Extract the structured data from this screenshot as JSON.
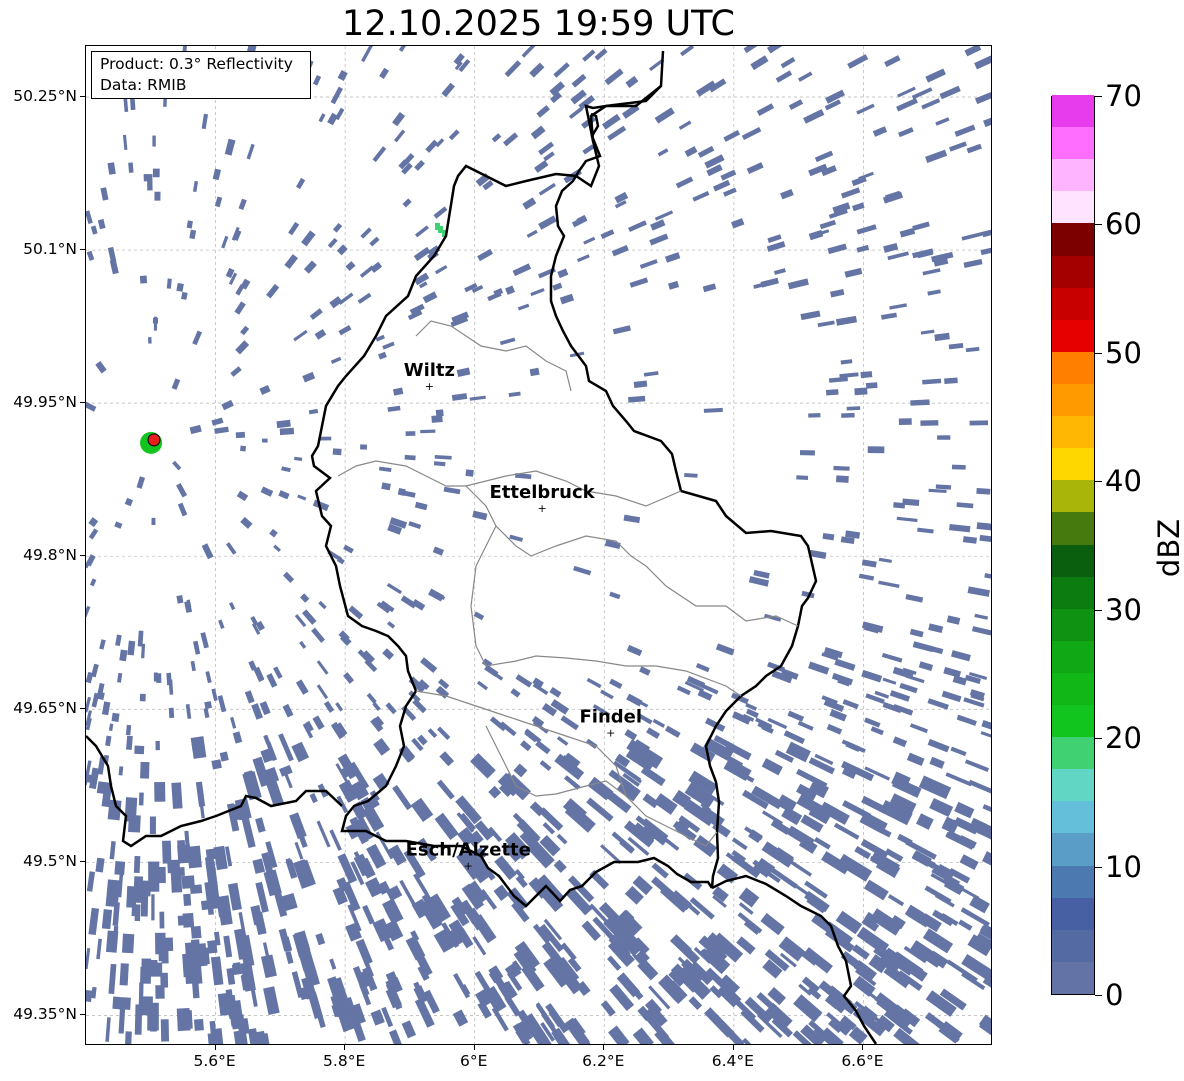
{
  "title": "12.10.2025 19:59 UTC",
  "info_box": {
    "product": "Product: 0.3° Reflectivity",
    "data": "Data: RMIB"
  },
  "map": {
    "lon_range": [
      5.4,
      6.8
    ],
    "lat_range": [
      49.32,
      50.3
    ],
    "grid": true,
    "lat_ticks": [
      {
        "value": 50.25,
        "label": "50.25°N"
      },
      {
        "value": 50.1,
        "label": "50.1°N"
      },
      {
        "value": 49.95,
        "label": "49.95°N"
      },
      {
        "value": 49.8,
        "label": "49.8°N"
      },
      {
        "value": 49.65,
        "label": "49.65°N"
      },
      {
        "value": 49.5,
        "label": "49.5°N"
      },
      {
        "value": 49.35,
        "label": "49.35°N"
      }
    ],
    "lon_ticks": [
      {
        "value": 5.6,
        "label": "5.6°E"
      },
      {
        "value": 5.8,
        "label": "5.8°E"
      },
      {
        "value": 6.0,
        "label": "6°E"
      },
      {
        "value": 6.2,
        "label": "6.2°E"
      },
      {
        "value": 6.4,
        "label": "6.4°E"
      },
      {
        "value": 6.6,
        "label": "6.6°E"
      }
    ],
    "cities": [
      {
        "name": "Wiltz",
        "lon": 5.93,
        "lat": 49.967
      },
      {
        "name": "Ettelbruck",
        "lon": 6.104,
        "lat": 49.847
      },
      {
        "name": "Findel",
        "lon": 6.21,
        "lat": 49.627
      },
      {
        "name": "Esch/Alzette",
        "lon": 5.99,
        "lat": 49.497
      }
    ],
    "radar_site": {
      "lon": 5.505,
      "lat": 49.914,
      "color": "#e8201c"
    },
    "echo_color": "#6475a5",
    "border_color": "#000000",
    "canton_color": "#888888"
  },
  "colorbar": {
    "label": "dBZ",
    "min": 0,
    "max": 70,
    "ticks": [
      {
        "value": 0,
        "label": "0"
      },
      {
        "value": 10,
        "label": "10"
      },
      {
        "value": 20,
        "label": "20"
      },
      {
        "value": 30,
        "label": "30"
      },
      {
        "value": 40,
        "label": "40"
      },
      {
        "value": 50,
        "label": "50"
      },
      {
        "value": 60,
        "label": "60"
      },
      {
        "value": 70,
        "label": "70"
      }
    ],
    "colors": [
      "#6473a6",
      "#546aa3",
      "#4660a3",
      "#4b79b0",
      "#5a9ec8",
      "#64c0da",
      "#62d6c5",
      "#40d272",
      "#12c41e",
      "#10b716",
      "#10a815",
      "#0f9211",
      "#0c7b10",
      "#095f0e",
      "#467a0e",
      "#aab50a",
      "#ffd700",
      "#ffb703",
      "#ff9a00",
      "#ff7f00",
      "#e60000",
      "#c80000",
      "#a50000",
      "#7d0000",
      "#ffe3ff",
      "#ffb4ff",
      "#ff6eff",
      "#e63ced"
    ]
  }
}
